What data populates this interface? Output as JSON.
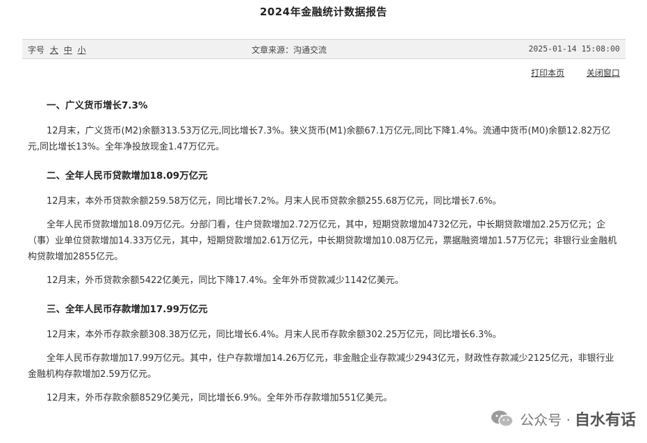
{
  "page": {
    "title": "2024年金融统计数据报告"
  },
  "meta": {
    "font_size_label": "字号",
    "font_sizes": [
      "大",
      "中",
      "小"
    ],
    "source_label": "文章来源：沟通交流",
    "datetime": "2025-01-14 15:08:00"
  },
  "actions": {
    "print": "打印本页",
    "close": "关闭窗口"
  },
  "sections": [
    {
      "heading": "一、广义货币增长7.3%",
      "paragraphs": [
        "12月末，广义货币(M2)余额313.53万亿元,同比增长7.3%。狭义货币(M1)余额67.1万亿元,同比下降1.4%。流通中货币(M0)余额12.82万亿元,同比增长13%。全年净投放现金1.47万亿元。"
      ]
    },
    {
      "heading": "二、全年人民币贷款增加18.09万亿元",
      "paragraphs": [
        "12月末，本外币贷款余额259.58万亿元，同比增长7.2%。月末人民币贷款余额255.68万亿元，同比增长7.6%。",
        "全年人民币贷款增加18.09万亿元。分部门看，住户贷款增加2.72万亿元，其中，短期贷款增加4732亿元，中长期贷款增加2.25万亿元；企（事）业单位贷款增加14.33万亿元，其中，短期贷款增加2.61万亿元，中长期贷款增加10.08万亿元，票据融资增加1.57万亿元；非银行业金融机构贷款增加2855亿元。",
        "12月末，外币贷款余额5422亿美元，同比下降17.4%。全年外币贷款减少1142亿美元。"
      ]
    },
    {
      "heading": "三、全年人民币存款增加17.99万亿元",
      "paragraphs": [
        "12月末，本外币存款余额308.38万亿元，同比增长6.4%。月末人民币存款余额302.25万亿元，同比增长6.3%。",
        "全年人民币存款增加17.99万亿元。其中，住户存款增加14.26万亿元，非金融企业存款减少2943亿元，财政性存款减少2125亿元，非银行业金融机构存款增加2.59万亿元。",
        "12月末，外币存款余额8529亿美元，同比增长6.9%。全年外币存款增加551亿美元。"
      ]
    }
  ],
  "watermark": {
    "platform": "公众号 ·",
    "account": "自水有话"
  }
}
